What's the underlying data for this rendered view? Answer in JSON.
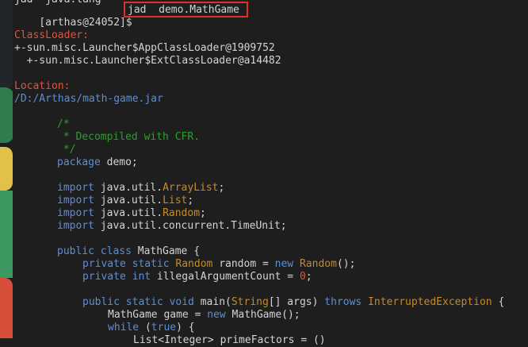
{
  "prev_line": "jad  java.lang",
  "prompt": "[arthas@24052]$",
  "command": "jad  demo.MathGame",
  "classloader_label": "ClassLoader:",
  "classloader_1": "+-sun.misc.Launcher$AppClassLoader@1909752",
  "classloader_2": "  +-sun.misc.Launcher$ExtClassLoader@a14482",
  "location_label": "Location:",
  "location_path": "/D:/Arthas/math-game.jar",
  "code": {
    "comment_open": "/*",
    "comment_text": " * Decompiled with CFR.",
    "comment_close": " */",
    "kw_package": "package",
    "package_name": " demo;",
    "kw_import": "import",
    "imp1_pkg": " java.util.",
    "imp1_cls": "ArrayList",
    "imp2_pkg": " java.util.",
    "imp2_cls": "List",
    "imp3_pkg": " java.util.",
    "imp3_cls": "Random",
    "imp4_pkg": " java.util.concurrent.TimeUnit;",
    "semicolon": ";",
    "kw_public_class": "public class",
    "class_decl": " MathGame {",
    "kw_private_static": "private static",
    "field1_type": " Random",
    "field1_mid": " random = ",
    "kw_new": "new",
    "field1_ctor": " Random",
    "field1_end": "();",
    "kw_private": "private",
    "kw_int": " int",
    "field2_mid": " illegalArgumentCount = ",
    "field2_val": "0",
    "kw_public_static_void": "public static void",
    "main_sig": " main(",
    "main_type": "String",
    "main_args": "[] args) ",
    "kw_throws": "throws",
    "main_exc": " InterruptedException",
    "main_brace": " {",
    "local_decl": "MathGame game = ",
    "local_ctor": " MathGame();",
    "kw_while": "while",
    "while_open": " (",
    "kw_true": "true",
    "while_close": ") {",
    "last_partial": "List<Integer> primeFactors = ()"
  }
}
